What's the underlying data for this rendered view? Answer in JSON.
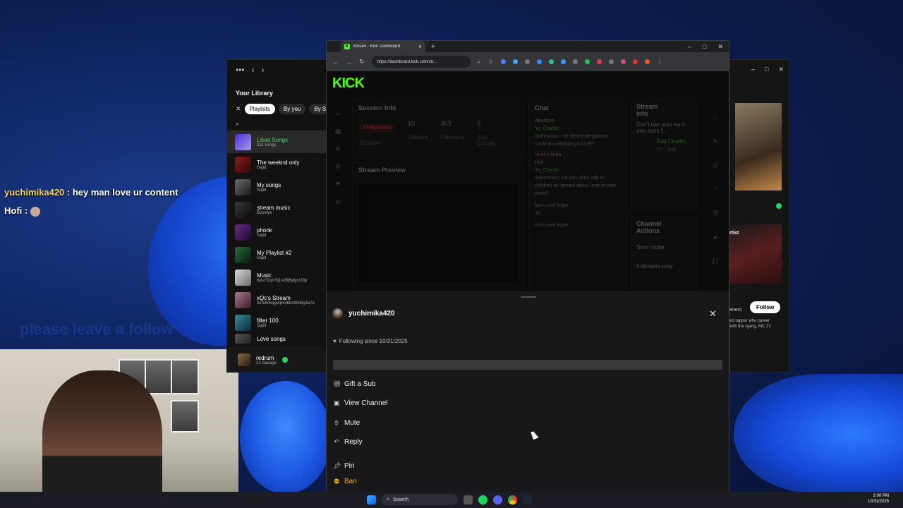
{
  "desktop": {
    "overlay_chat": [
      {
        "user": "yuchimika420",
        "text": ": hey man love ur content"
      },
      {
        "user": "Hofi",
        "text": ":"
      }
    ],
    "faded_text": "please leave a follow"
  },
  "spotify": {
    "library_title": "Your Library",
    "chips": [
      "Playlists",
      "By you",
      "By Spotify"
    ],
    "items": [
      {
        "name": "Liked Songs",
        "sub": "311 songs"
      },
      {
        "name": "The weeknd only",
        "sub": "Sajid"
      },
      {
        "name": "My songs",
        "sub": "Sajid"
      },
      {
        "name": "stream music",
        "sub": "Bulzeye"
      },
      {
        "name": "phonk",
        "sub": "Sajid"
      },
      {
        "name": "My Playlist #2",
        "sub": "Sajid"
      },
      {
        "name": "Music",
        "sub": "9ylvi7tzpv5j1sd5j8ylgm33p"
      },
      {
        "name": "xQc's Stream",
        "sub": "31m6dkqgvqbmbbz6hdkg4a7e"
      },
      {
        "name": "filter 100",
        "sub": "Sajid"
      },
      {
        "name": "Love songs",
        "sub": ""
      }
    ],
    "now_playing": {
      "title": "redrum",
      "artist": "21 Savage"
    }
  },
  "right_window": {
    "follow_label": "Follow",
    "artist_label": "rtist",
    "listeners": "eners",
    "bio": "ed rapper who career with the rgang, MC 21"
  },
  "browser": {
    "tab_title": "Stream - Kick Dashboard",
    "url": "https://dashboard.kick.com/str..."
  },
  "dashboard": {
    "logo": "KICK",
    "session_info": {
      "title": "Session Info",
      "status": "STREAMING",
      "session_label": "Session",
      "stats": [
        {
          "value": "10",
          "label": "Viewers"
        },
        {
          "value": "363",
          "label": "Followers"
        },
        {
          "value": "2",
          "label": "Sub Counts"
        }
      ]
    },
    "stream_preview": "Stream Preview",
    "chat": {
      "title": "Chat",
      "lines": [
        {
          "user": "woodzye",
          "text": ""
        },
        {
          "user": "Yo_Cracky:",
          "text": ""
        },
        {
          "user": "",
          "text": "Sammmau: I've heard allegations, could you explain yourself?"
        },
        {
          "user": "Niatiru",
          "text": "lmao"
        },
        {
          "user": "Hofi:",
          "text": ""
        },
        {
          "user": "Yo_Cracky:",
          "text": ""
        },
        {
          "user": "",
          "text": "Sammmau: Do you often talk to children on games about their private parts?"
        },
        {
          "user": "Iram",
          "text": "sent Hype"
        },
        {
          "user": "",
          "text": "10"
        },
        {
          "user": "Iram",
          "text": "sent Hype"
        }
      ]
    },
    "stream_info": {
      "title": "Stream Info",
      "text": "Don't use your ears and eyes f...",
      "link": "Just Chattin",
      "badges": [
        "18+",
        "Engl"
      ]
    },
    "channel_actions": {
      "title": "Channel Actions",
      "items": [
        "Slow mode",
        "Followers-only"
      ]
    }
  },
  "user_card": {
    "username": "yuchimika420",
    "following_since": "Following since 10/31/2025",
    "actions": [
      {
        "label": "Gift a Sub",
        "icon": "gift-icon"
      },
      {
        "label": "View Channel",
        "icon": "channel-icon"
      },
      {
        "label": "Mute",
        "icon": "mute-icon"
      },
      {
        "label": "Reply",
        "icon": "reply-icon"
      },
      {
        "label": "Pin",
        "icon": "pin-icon"
      },
      {
        "label": "Ban",
        "icon": "ban-icon"
      }
    ]
  },
  "taskbar": {
    "search_placeholder": "Search",
    "time": "2:00 PM",
    "date": "10/31/2025"
  },
  "colors": {
    "kick_green": "#53fc18",
    "ban_yellow": "#f5b400",
    "card_bg": "#18181b"
  }
}
